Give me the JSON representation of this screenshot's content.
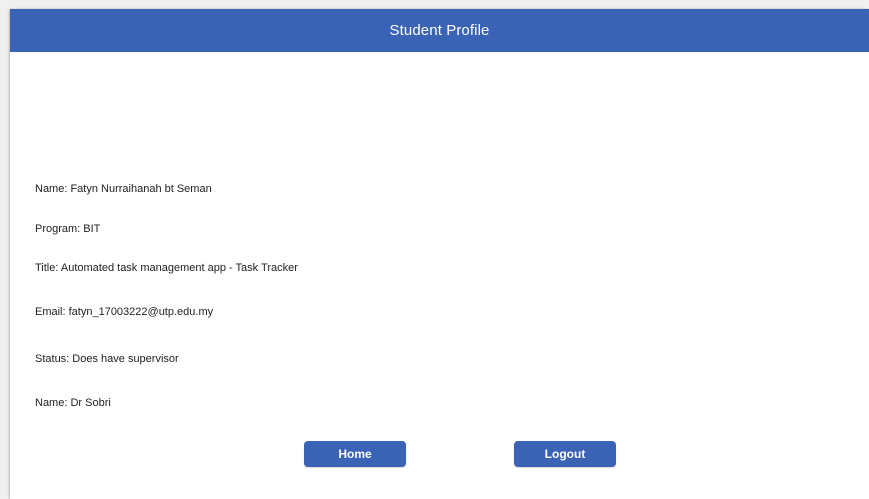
{
  "header": {
    "title": "Student Profile"
  },
  "profile": {
    "name_line": "Name:  Fatyn Nurraihanah bt Seman",
    "program_line": "Program: BIT",
    "title_line": "Title: Automated task management app - Task Tracker",
    "email_line": "Email: fatyn_17003222@utp.edu.my",
    "status_line": "Status: Does have supervisor",
    "supervisor_line": "Name: Dr Sobri"
  },
  "actions": {
    "home_label": "Home",
    "logout_label": "Logout"
  },
  "colors": {
    "accent": "#3a62b5",
    "background": "#ffffff",
    "text": "#222222"
  }
}
